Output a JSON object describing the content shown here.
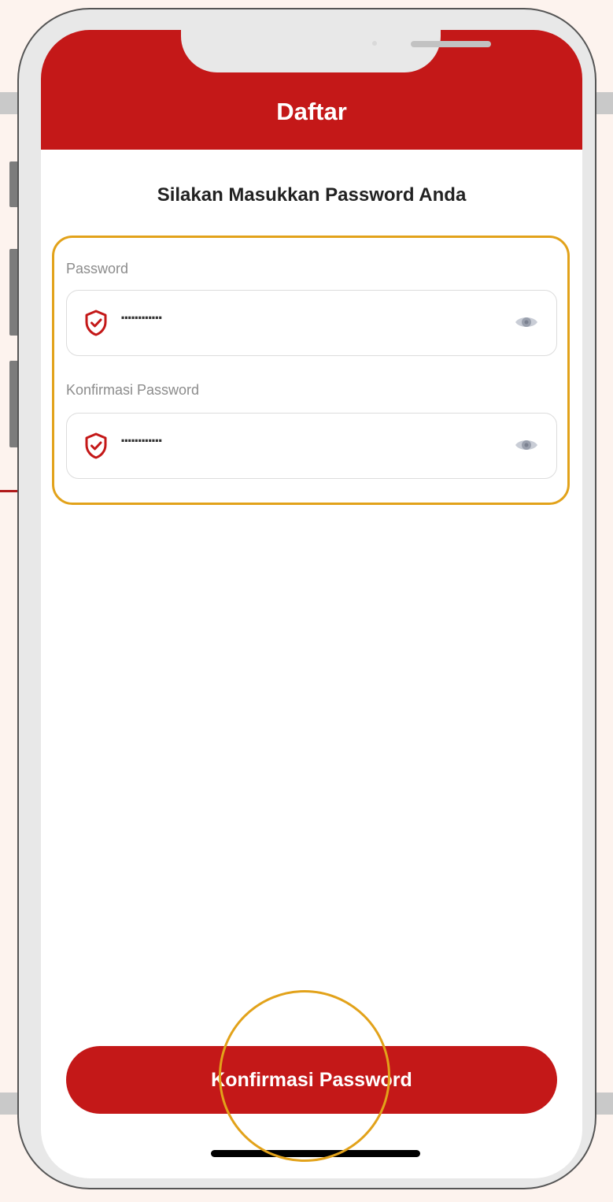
{
  "header": {
    "title": "Daftar"
  },
  "page": {
    "heading": "Silakan Masukkan Password Anda"
  },
  "form": {
    "password": {
      "label": "Password",
      "masked_value": "············",
      "icon": "shield-check-icon",
      "toggle_icon": "eye-icon"
    },
    "confirm_password": {
      "label": "Konfirmasi Password",
      "masked_value": "············",
      "icon": "shield-check-icon",
      "toggle_icon": "eye-icon"
    }
  },
  "actions": {
    "confirm_label": "Konfirmasi Password"
  },
  "colors": {
    "brand_red": "#c41818",
    "highlight": "#e2a21a",
    "background": "#fdf3ee"
  }
}
